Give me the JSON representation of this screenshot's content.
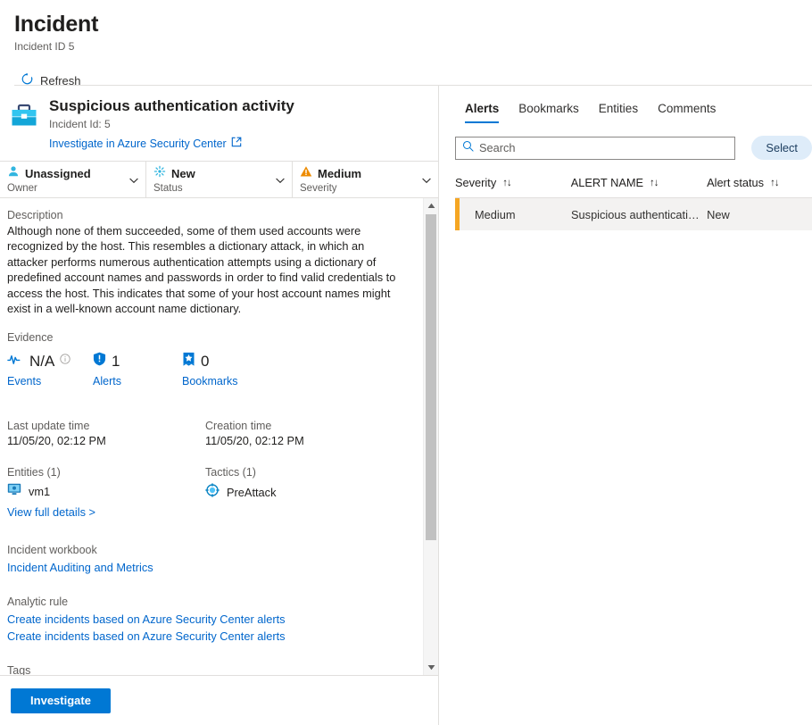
{
  "header": {
    "title": "Incident",
    "subtitle": "Incident ID 5",
    "refresh_label": "Refresh"
  },
  "incident": {
    "name": "Suspicious authentication activity",
    "id_label": "Incident Id: 5",
    "external_link": "Investigate in Azure Security Center",
    "properties": [
      {
        "value": "Unassigned",
        "label": "Owner",
        "icon": "person-icon"
      },
      {
        "value": "New",
        "label": "Status",
        "icon": "new-status-icon"
      },
      {
        "value": "Medium",
        "label": "Severity",
        "icon": "warning-icon"
      }
    ]
  },
  "details": {
    "description_label": "Description",
    "description": "Although none of them succeeded, some of them used accounts were recognized by the host. This resembles a dictionary attack, in which an attacker performs numerous authentication attempts using a dictionary of predefined account names and passwords in order to find valid credentials to access the host. This indicates that some of your host account names might exist in a well-known account name dictionary.",
    "evidence_label": "Evidence",
    "evidence": [
      {
        "count": "N/A",
        "name": "Events",
        "icon": "pulse-icon",
        "has_info": true
      },
      {
        "count": "1",
        "name": "Alerts",
        "icon": "shield-icon",
        "has_info": false
      },
      {
        "count": "0",
        "name": "Bookmarks",
        "icon": "bookmark-icon",
        "has_info": false
      }
    ],
    "last_update_label": "Last update time",
    "last_update_value": "11/05/20, 02:12 PM",
    "creation_label": "Creation time",
    "creation_value": "11/05/20, 02:12 PM",
    "entities_label": "Entities (1)",
    "entity_name": "vm1",
    "view_full_details": "View full details >",
    "tactics_label": "Tactics (1)",
    "tactic_name": "PreAttack",
    "workbook_label": "Incident workbook",
    "workbook_link": "Incident Auditing and Metrics",
    "analytic_rule_label": "Analytic rule",
    "analytic_rule_links": [
      "Create incidents based on Azure Security Center alerts",
      "Create incidents based on Azure Security Center alerts"
    ],
    "tags_label": "Tags"
  },
  "footer": {
    "investigate_label": "Investigate"
  },
  "right_panel": {
    "tabs": [
      {
        "label": "Alerts",
        "active": true
      },
      {
        "label": "Bookmarks",
        "active": false
      },
      {
        "label": "Entities",
        "active": false
      },
      {
        "label": "Comments",
        "active": false
      }
    ],
    "search_placeholder": "Search",
    "search_value": "",
    "action_button": "Select",
    "table": {
      "columns": [
        "Severity",
        "ALERT NAME",
        "Alert status"
      ],
      "sort_glyph": "↑↓",
      "rows": [
        {
          "severity": "Medium",
          "alert_name": "Suspicious authenticatio...",
          "alert_status": "New",
          "severity_color": "#f5a623"
        }
      ]
    }
  },
  "colors": {
    "accent": "#0078d4",
    "link": "#0066cc",
    "medium_severity": "#f5a623",
    "icon_cyan": "#2bb8e0"
  }
}
